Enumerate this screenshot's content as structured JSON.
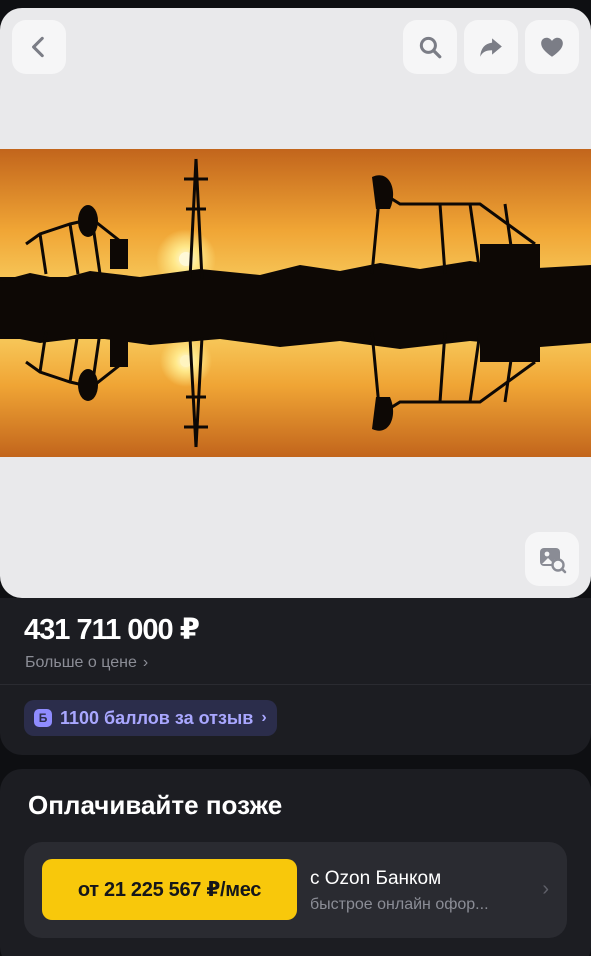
{
  "header": {
    "back_icon": "chevron-left-icon",
    "search_icon": "search-icon",
    "share_icon": "share-arrow-icon",
    "favorite_icon": "heart-icon"
  },
  "gallery": {
    "visual_search_icon": "image-search-icon"
  },
  "price": {
    "amount": "431 711 000 ₽",
    "more_label": "Больше о цене",
    "more_chevron": "›"
  },
  "points": {
    "badge": "Б",
    "label": "1100 баллов за отзыв",
    "chevron": "›"
  },
  "pay_later": {
    "title": "Оплачивайте позже",
    "installment": "от 21 225 567 ₽/мес",
    "bank": "с Ozon Банком",
    "subtitle": "быстрое онлайн офор...",
    "chevron": "›"
  },
  "colors": {
    "background": "#0e0f12",
    "card": "#1c1d22",
    "accent_yellow": "#f8c80b",
    "points_bg": "#2b2d4b",
    "points_text": "#a9a7ff"
  }
}
